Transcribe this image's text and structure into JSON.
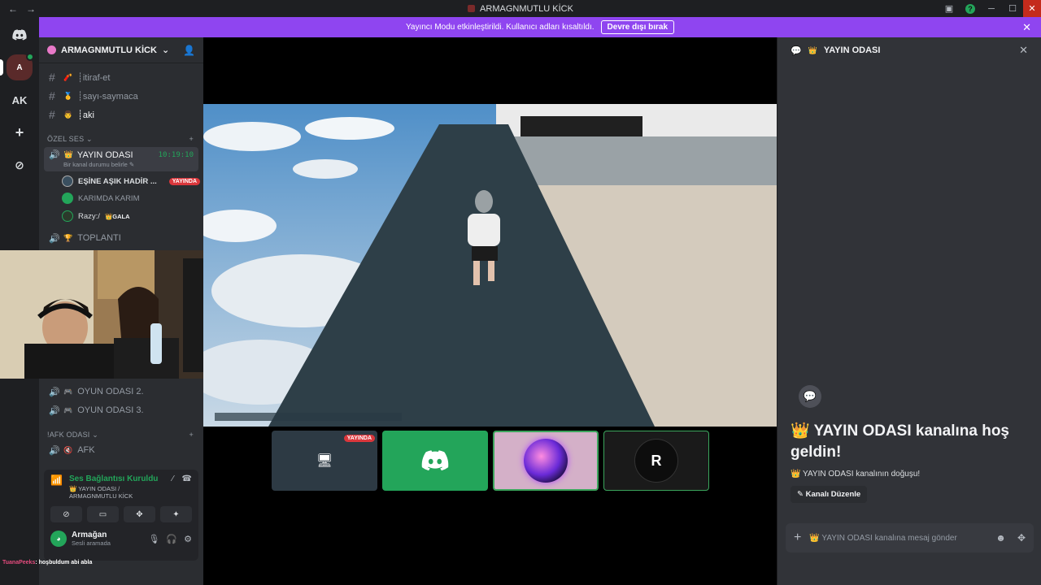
{
  "titlebar": {
    "back": "←",
    "forward": "→",
    "title": "ARMAGNMUTLU KİCK",
    "help": "?",
    "minimize": "─",
    "maximize": "☐",
    "close": "✕"
  },
  "rail": {
    "ak_label": "AK",
    "add": "+",
    "explore": "⊘"
  },
  "banner": {
    "text": "Yayıncı Modu etkinleştirildi. Kullanıcı adları kısaltıldı.",
    "button": "Devre dışı bırak",
    "close": "✕"
  },
  "server": {
    "name": "ARMAGNMUTLU KİCK",
    "chevron": "⌄"
  },
  "channels": [
    {
      "name": "┊itiraf-et",
      "emoji": "🧨"
    },
    {
      "name": "┊sayı-saymaca",
      "emoji": "🥇"
    },
    {
      "name": "┊aki",
      "emoji": "👨"
    }
  ],
  "category_voice": {
    "name": "ÖZEL SES",
    "plus": "+"
  },
  "active_voice": {
    "name": "YAYIN ODASI",
    "emoji": "👑",
    "timer": "10:19:10",
    "status": "Bir kanal durumu belirle"
  },
  "voice_users": [
    {
      "name": "EŞİNE AŞIK HADİR ...",
      "live": "YAYINDA"
    },
    {
      "name": "KARIMDA KARIM"
    },
    {
      "name": "Razy:/",
      "badge": "👑GALA"
    }
  ],
  "voice_channels": [
    {
      "name": "TOPLANTI",
      "emoji": "🏆"
    },
    {
      "name": "OYUN ODASI 2.",
      "emoji": "🎮"
    },
    {
      "name": "OYUN ODASI 3.",
      "emoji": "🎮"
    }
  ],
  "category_afk": {
    "name": "!AFK ODASI",
    "plus": "+"
  },
  "afk_channel": {
    "name": "AFK",
    "emoji": "🔇"
  },
  "voice_panel": {
    "status": "Ses Bağlantısı Kuruldu",
    "sub": "👑 YAYIN ODASI / ARMAGNMUTLU KİCK"
  },
  "user": {
    "name": "Armağan",
    "status": "Sesli aramada"
  },
  "chat_overlay": {
    "nick": "TuanaPeeks",
    "message": ": hoşbuldum abi abla"
  },
  "stage": {
    "thumb_live": "YAYINDA",
    "logo_text": "R"
  },
  "chat_panel": {
    "title": "YAYIN ODASI",
    "emoji": "👑",
    "welcome_title": "👑 YAYIN ODASI kanalına hoş geldin!",
    "welcome_sub": "👑 YAYIN ODASI kanalının doğuşu!",
    "edit_button": "✎ Kanalı Düzenle",
    "composer_placeholder": "👑 YAYIN ODASI kanalına mesaj gönder"
  },
  "colors": {
    "accent": "#8f45f0",
    "online": "#23a55a",
    "live": "#da373c"
  }
}
